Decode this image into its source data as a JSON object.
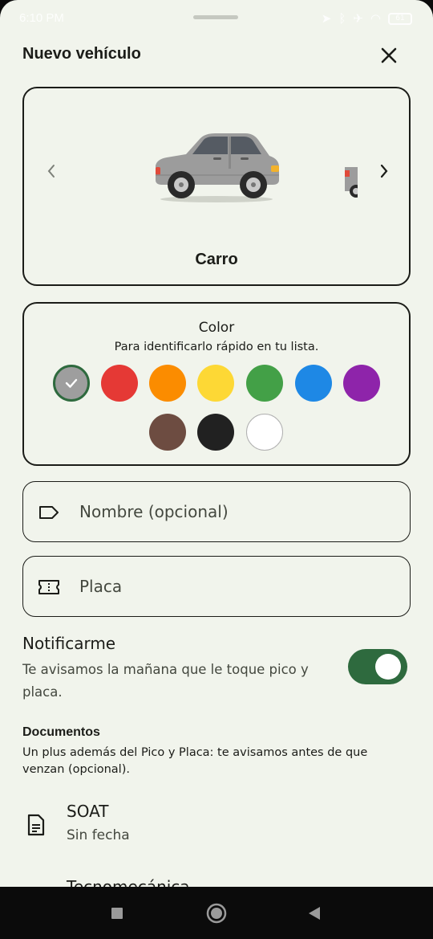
{
  "status_bar": {
    "time": "6:10 PM",
    "icons": [
      "location-icon",
      "bluetooth-icon",
      "airplane-icon",
      "wifi-icon",
      "battery-icon"
    ],
    "battery": "61"
  },
  "sheet": {
    "title": "Nuevo vehículo",
    "close_icon": "close-icon"
  },
  "vehicle_selector": {
    "selected_label": "Carro",
    "prev_icon": "chevron-left-icon",
    "next_icon": "chevron-right-icon"
  },
  "color_picker": {
    "title": "Color",
    "subtitle": "Para identificarlo rápido en tu lista.",
    "selected_index": 0,
    "swatches": [
      {
        "name": "gray",
        "hex": "#9e9e9e"
      },
      {
        "name": "red",
        "hex": "#e53935"
      },
      {
        "name": "orange",
        "hex": "#fb8c00"
      },
      {
        "name": "yellow",
        "hex": "#fdd835"
      },
      {
        "name": "green",
        "hex": "#43a047"
      },
      {
        "name": "blue",
        "hex": "#1e88e5"
      },
      {
        "name": "purple",
        "hex": "#8e24aa"
      },
      {
        "name": "brown",
        "hex": "#6d4c41"
      },
      {
        "name": "black",
        "hex": "#212121"
      },
      {
        "name": "white",
        "hex": "#ffffff"
      }
    ]
  },
  "fields": {
    "name": {
      "placeholder": "Nombre (opcional)",
      "value": "",
      "icon": "label-icon"
    },
    "plate": {
      "placeholder": "Placa",
      "value": "",
      "icon": "ticket-icon"
    }
  },
  "notify": {
    "title": "Notificarme",
    "description": "Te avisamos la mañana que le toque pico y placa.",
    "enabled": true
  },
  "documents": {
    "title": "Documentos",
    "description": "Un plus además del Pico y Placa: te avisamos antes de que venzan (opcional).",
    "items": [
      {
        "name": "SOAT",
        "date": "Sin fecha",
        "icon": "document-icon"
      },
      {
        "name": "Tecnomecánica",
        "date": ""
      }
    ]
  },
  "colors": {
    "background": "#f1f4ec",
    "accent": "#2e6a3e",
    "text": "#1b1c18"
  },
  "nav_bar": {
    "icons": [
      "recents-icon",
      "home-icon",
      "back-icon"
    ]
  }
}
